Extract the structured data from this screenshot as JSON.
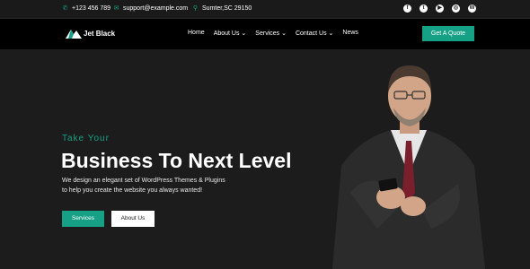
{
  "topbar": {
    "phone": "+123 456 789",
    "email": "support@example.com",
    "address": "Sumter,SC 29150",
    "socials": [
      "facebook-icon",
      "twitter-icon",
      "youtube-icon",
      "instagram-icon",
      "wordpress-icon"
    ]
  },
  "navbar": {
    "logo_text": "Jet Black",
    "items": [
      {
        "label": "Home"
      },
      {
        "label": "About Us ⌄"
      },
      {
        "label": "Services ⌄"
      },
      {
        "label": "Contact Us ⌄"
      },
      {
        "label": "News"
      }
    ],
    "cta_label": "Get A Quote"
  },
  "hero": {
    "kicker": "Take Your",
    "headline": "Business To Next Level",
    "description_line1": "We design an elegant set of WordPress Themes & Plugins",
    "description_line2": "to help you create the website you always wanted!",
    "primary_button": "Services",
    "secondary_button": "About Us"
  },
  "colors": {
    "accent": "#16a085",
    "background": "#1c1c1c",
    "navbar": "#000000"
  }
}
